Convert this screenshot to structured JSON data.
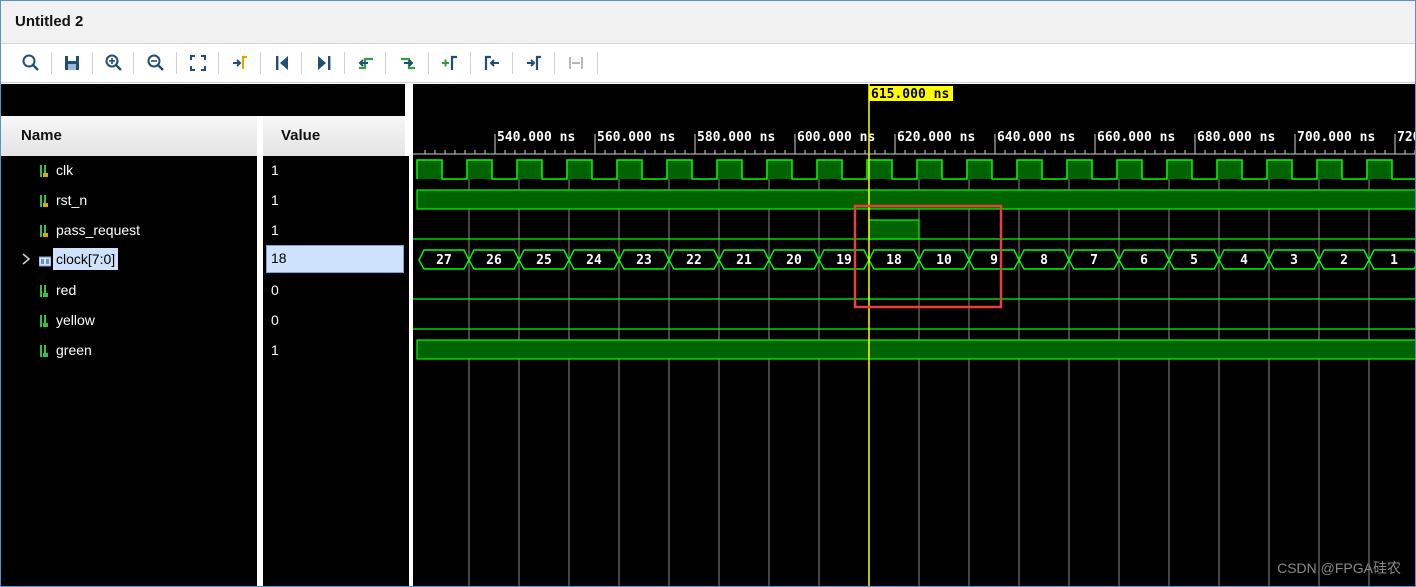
{
  "window": {
    "title": "Untitled 2"
  },
  "toolbar": {
    "buttons": [
      "search-icon",
      "save-icon",
      "zoom-in-icon",
      "zoom-out-icon",
      "zoom-fit-icon",
      "go-to-cursor-icon",
      "go-to-time-zero-icon",
      "go-to-last-time-icon",
      "previous-transition-icon",
      "next-transition-icon",
      "add-marker-icon",
      "previous-marker-icon",
      "next-marker-icon",
      "swap-cursors-icon"
    ]
  },
  "columns": {
    "name": "Name",
    "value": "Value"
  },
  "signals": [
    {
      "name": "clk",
      "value": "1"
    },
    {
      "name": "rst_n",
      "value": "1"
    },
    {
      "name": "pass_request",
      "value": "1"
    },
    {
      "name": "clock[7:0]",
      "value": "18"
    },
    {
      "name": "red",
      "value": "0"
    },
    {
      "name": "yellow",
      "value": "0"
    },
    {
      "name": "green",
      "value": "1"
    }
  ],
  "cursor": {
    "label": "615.000 ns"
  },
  "timeline": {
    "ticks": [
      "540.000 ns",
      "560.000 ns",
      "580.000 ns",
      "600.000 ns",
      "620.000 ns",
      "640.000 ns",
      "660.000 ns",
      "680.000 ns",
      "700.000 ns",
      "720"
    ]
  },
  "bus_values": [
    "27",
    "26",
    "25",
    "24",
    "23",
    "22",
    "21",
    "20",
    "19",
    "18",
    "10",
    "9",
    "8",
    "7",
    "6",
    "5",
    "4",
    "3",
    "2",
    "1"
  ],
  "colors": {
    "wave": "#00ff00",
    "wave_fill": "#006400",
    "cursor": "#ffff00",
    "highlight_box": "#e8413c",
    "selection": "#cfe2fb"
  },
  "watermark": "CSDN @FPGA硅农"
}
